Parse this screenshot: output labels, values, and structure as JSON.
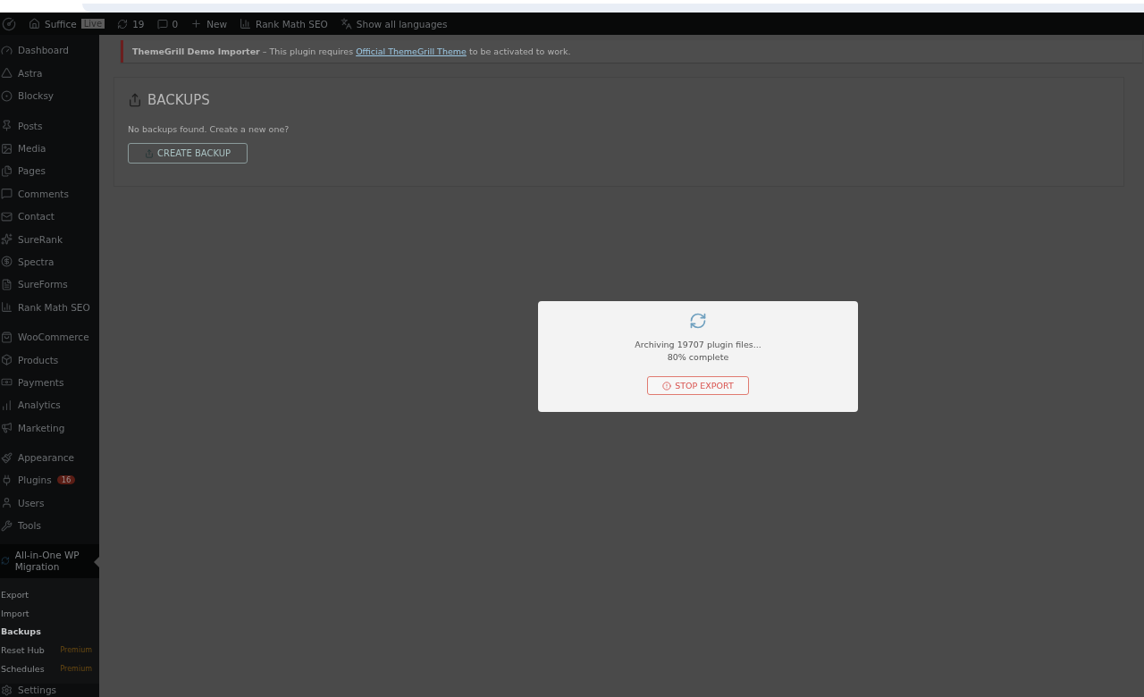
{
  "admin_bar": {
    "site": "Suffice",
    "live_badge": "Live",
    "updates": "19",
    "comments": "0",
    "new": "New",
    "seo": "Rank Math SEO",
    "languages": "Show all languages"
  },
  "sidebar": {
    "groups": [
      [
        {
          "label": "Dashboard"
        },
        {
          "label": "Astra"
        },
        {
          "label": "Blocksy"
        }
      ],
      [
        {
          "label": "Posts"
        },
        {
          "label": "Media"
        },
        {
          "label": "Pages"
        },
        {
          "label": "Comments"
        },
        {
          "label": "Contact"
        },
        {
          "label": "SureRank"
        },
        {
          "label": "Spectra"
        },
        {
          "label": "SureForms"
        },
        {
          "label": "Rank Math SEO"
        }
      ],
      [
        {
          "label": "WooCommerce"
        },
        {
          "label": "Products"
        },
        {
          "label": "Payments"
        },
        {
          "label": "Analytics"
        },
        {
          "label": "Marketing"
        }
      ],
      [
        {
          "label": "Appearance"
        },
        {
          "label": "Plugins",
          "badge": "16"
        },
        {
          "label": "Users"
        },
        {
          "label": "Tools"
        }
      ]
    ],
    "current": {
      "label": "All-in-One WP Migration",
      "submenu": [
        {
          "label": "Export",
          "selected": false
        },
        {
          "label": "Import",
          "selected": false
        },
        {
          "label": "Backups",
          "selected": true
        },
        {
          "label": "Reset Hub",
          "selected": false,
          "tag": "Premium"
        },
        {
          "label": "Schedules",
          "selected": false,
          "tag": "Premium"
        }
      ]
    },
    "after": [
      {
        "label": "Settings"
      }
    ]
  },
  "notice": {
    "title": "ThemeGrill Demo Importer",
    "text": " – This plugin requires ",
    "link": "Official ThemeGrill Theme",
    "after": " to be activated to work."
  },
  "backups": {
    "title": "BACKUPS",
    "empty": "No backups found. Create a new one?",
    "button": "CREATE BACKUP"
  },
  "modal": {
    "line1": "Archiving 19707 plugin files...",
    "line2": "80% complete",
    "button": "STOP EXPORT"
  }
}
